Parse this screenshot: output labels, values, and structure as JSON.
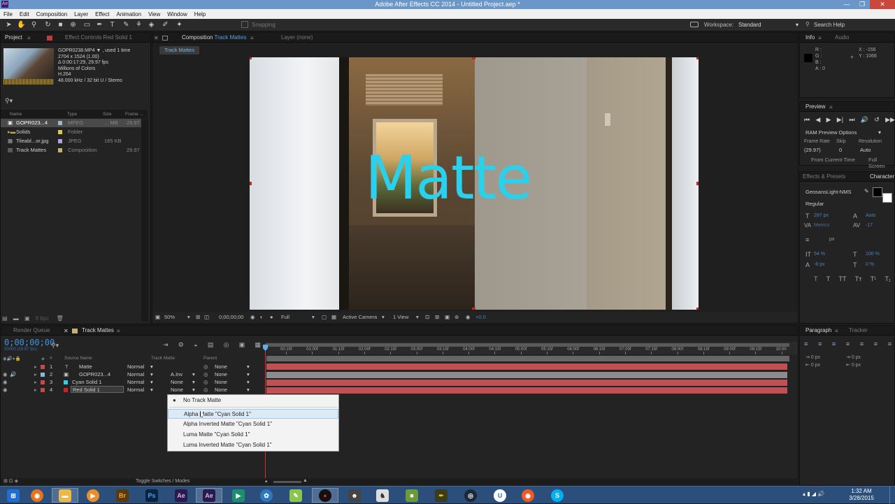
{
  "window": {
    "title": "Adobe After Effects CC 2014 - Untitled Project.aep *",
    "app_icon": "Ae"
  },
  "menu": [
    "File",
    "Edit",
    "Composition",
    "Layer",
    "Effect",
    "Animation",
    "View",
    "Window",
    "Help"
  ],
  "toolbar": {
    "snapping_label": "Snapping",
    "workspace_label": "Workspace:",
    "workspace_value": "Standard",
    "search_help": "Search Help"
  },
  "project_panel": {
    "tab_project": "Project",
    "tab_effect_controls": "Effect Controls Red Solid 1",
    "selected_item": {
      "name": "GOPR0238.MP4 ▼ , used 1 time",
      "line1": "2704 x 1524 (1.00)",
      "line2": "Δ 0:00:17:29, 29.97 fps",
      "line3": "Millions of Colors",
      "line4": "H.264",
      "line5": "48.000 kHz / 32 bit U / Stereo"
    },
    "columns": [
      "Name",
      "Type",
      "Size",
      "Frame ..."
    ],
    "items": [
      {
        "name": "GOPR023...4",
        "type": "MPEG",
        "size": "... MB",
        "frame": "29.97"
      },
      {
        "name": "Solids",
        "type": "Folder",
        "size": "",
        "frame": ""
      },
      {
        "name": "Tileabl...or.jpg",
        "type": "JPEG",
        "size": "185 KB",
        "frame": ""
      },
      {
        "name": "Track Mattes",
        "type": "Composition",
        "size": "",
        "frame": "29.97"
      }
    ],
    "bpc": "8 bpc"
  },
  "comp_panel": {
    "tab_label": "Composition",
    "tab_comp_name": "Track Mattes",
    "layer_tab": "Layer (none)",
    "breadcrumb": "Track Mattes",
    "matte_text": "Matte",
    "footer": {
      "zoom": "50%",
      "timecode": "0;00;00;00",
      "resolution": "Full",
      "camera": "Active Camera",
      "views": "1 View",
      "offset": "+0.0"
    }
  },
  "info_panel": {
    "tab_info": "Info",
    "tab_audio": "Audio",
    "r": "R :",
    "g": "G :",
    "b": "B :",
    "a": "A : 0",
    "x": "X : -156",
    "y": "Y : 1066"
  },
  "preview_panel": {
    "title": "Preview",
    "ram_options": "RAM Preview Options",
    "frame_rate_label": "Frame Rate",
    "skip_label": "Skip",
    "resolution_label": "Resolution",
    "frame_rate": "(29.97)",
    "skip": "0",
    "resolution": "Auto",
    "from_current": "From Current Time",
    "full_screen": "Full Screen"
  },
  "character_panel": {
    "tab_effects": "Effects & Presets",
    "tab_character": "Character",
    "font": "GeosansLight-NMS",
    "style": "Regular",
    "size": "287 px",
    "leading": "Auto",
    "kerning": "Metrics",
    "tracking": "-17",
    "stroke_unit": "px",
    "vscale": "54 %",
    "hscale": "100 %",
    "baseline": "-8 px",
    "tsume": "0 %"
  },
  "paragraph_panel": {
    "tab_paragraph": "Paragraph",
    "tab_tracker": "Tracker",
    "indent1": "0 px",
    "indent2": "0 px",
    "indent3": "0 px",
    "space1": "0 px",
    "space2": "0 px"
  },
  "timeline": {
    "tab_render_queue": "Render Queue",
    "tab_comp": "Track Mattes",
    "timecode": "0;00;00;00",
    "fps": "00000 (29.97 fps)",
    "col_source": "Source Name",
    "col_trackmatte": "Track Matte",
    "col_parent": "Parent",
    "ruler": [
      "00:15f",
      "01:00f",
      "01:15f",
      "02:00f",
      "02:15f",
      "03:00f",
      "03:15f",
      "04:00f",
      "04:15f",
      "05:00f",
      "05:15f",
      "06:00f",
      "06:15f",
      "07:00f",
      "07:15f",
      "08:00f",
      "08:15f",
      "09:00f",
      "09:15f",
      "10:00"
    ],
    "layers": [
      {
        "num": "1",
        "name": "Matte",
        "mode": "Normal",
        "trkmat": "",
        "parent": "None",
        "color": "#c64a4a"
      },
      {
        "num": "2",
        "name": "GOPR023...4",
        "mode": "Normal",
        "trkmat": "A.Inv",
        "parent": "None",
        "color": "#8fb8cf"
      },
      {
        "num": "3",
        "name": "Cyan Solid 1",
        "mode": "Normal",
        "trkmat": "None",
        "parent": "None",
        "color": "#c64a4a"
      },
      {
        "num": "4",
        "name": "Red Solid 1",
        "mode": "Normal",
        "trkmat": "None",
        "parent": "None",
        "color": "#c64a4a"
      }
    ],
    "toggle_label": "Toggle Switches / Modes"
  },
  "dropdown": {
    "items": [
      "No Track Matte",
      "Alpha Matte \"Cyan Solid 1\"",
      "Alpha Inverted Matte \"Cyan Solid 1\"",
      "Luma Matte \"Cyan Solid 1\"",
      "Luma Inverted Matte \"Cyan Solid 1\""
    ]
  },
  "taskbar": {
    "apps": [
      "start",
      "firefox",
      "explorer",
      "media",
      "Br",
      "Ps",
      "Ae",
      "Ae",
      "app-green",
      "app-blue",
      "app-notepad",
      "record",
      "app-game",
      "app-2",
      "minecraft",
      "app-feather",
      "steam",
      "uplay",
      "app-orange",
      "skype"
    ],
    "time": "1:32 AM",
    "date": "3/28/2015"
  }
}
